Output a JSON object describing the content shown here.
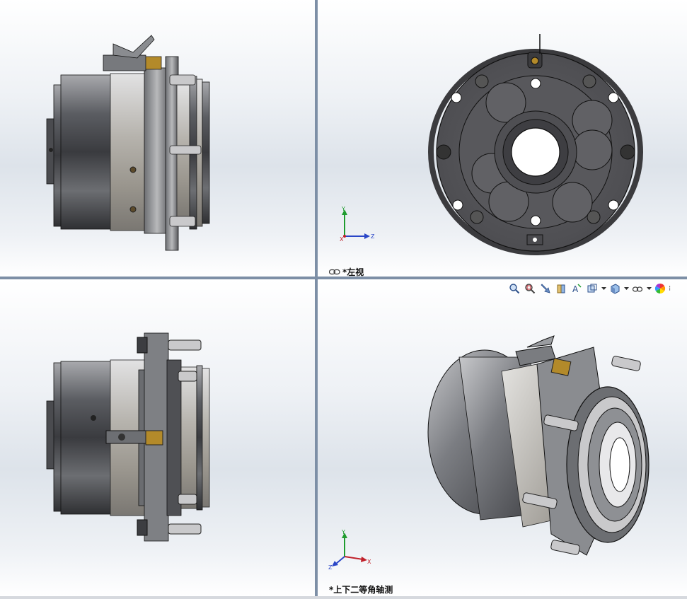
{
  "viewports": {
    "front": {
      "label": ""
    },
    "left": {
      "label": "*左视"
    },
    "top": {
      "label": ""
    },
    "iso": {
      "label": "*上下二等角轴测"
    }
  },
  "triad_axes": {
    "left_view": {
      "y": "Y",
      "z": "Z",
      "x": "X"
    },
    "iso_view": {
      "y": "Y",
      "z": "Z",
      "x": "X"
    }
  },
  "toolbar": {
    "icons": [
      "zoom-to-fit-icon",
      "zoom-to-area-icon",
      "previous-view-icon",
      "section-view-icon",
      "dynamic-annotation-icon",
      "view-orientation-icon",
      "display-style-icon",
      "hide-show-items-icon",
      "appearance-icon"
    ],
    "more": "⁝"
  },
  "colors": {
    "metal_dark": "#3c3c3e",
    "metal_mid": "#6e7074",
    "metal_light": "#c9c9cb",
    "brass": "#b38a2a",
    "axis_x": "#c0202a",
    "axis_y": "#1f9c2e",
    "axis_z": "#2a46c7"
  }
}
